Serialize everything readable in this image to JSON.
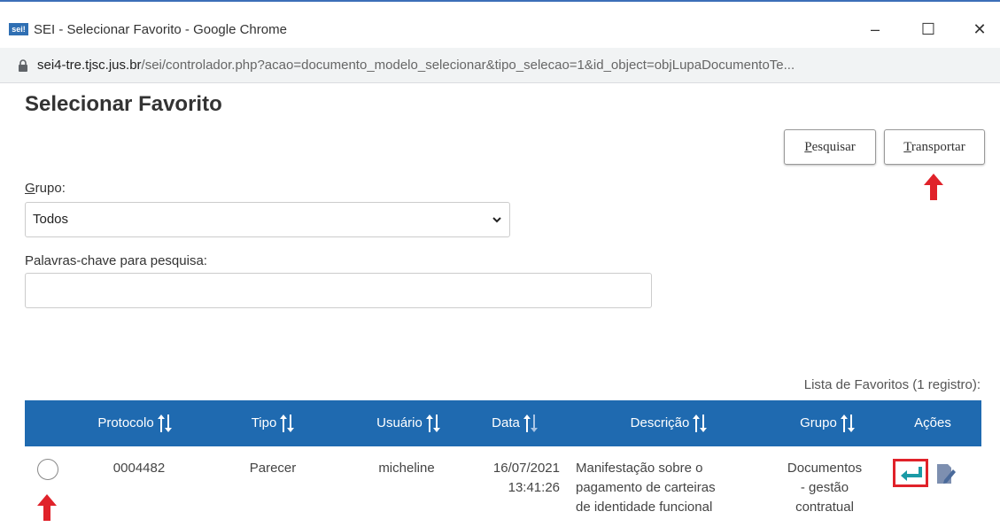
{
  "window": {
    "icon_text": "sei!",
    "title": "SEI - Selecionar Favorito - Google Chrome",
    "minimize": "–",
    "maximize": "☐",
    "close": "✕"
  },
  "address": {
    "host": "sei4-tre.tjsc.jus.br",
    "path": "/sei/controlador.php?acao=documento_modelo_selecionar&tipo_selecao=1&id_object=objLupaDocumentoTe..."
  },
  "page": {
    "title": "Selecionar Favorito",
    "buttons": {
      "pesquisar_accesskey": "P",
      "pesquisar_rest": "esquisar",
      "transportar_accesskey": "T",
      "transportar_rest": "ransportar"
    },
    "grupo": {
      "label_accesskey": "G",
      "label_rest": "rupo:",
      "selected": "Todos"
    },
    "keywords": {
      "label": "Palavras-chave para pesquisa:",
      "value": ""
    },
    "list_caption": "Lista de Favoritos (1 registro):"
  },
  "table": {
    "headers": {
      "protocolo": "Protocolo",
      "tipo": "Tipo",
      "usuario": "Usuário",
      "data": "Data",
      "descricao": "Descrição",
      "grupo": "Grupo",
      "acoes": "Ações"
    },
    "rows": [
      {
        "protocolo": "0004482",
        "tipo": "Parecer",
        "usuario": "micheline",
        "data_date": "16/07/2021",
        "data_time": "13:41:26",
        "descricao_1": "Manifestação sobre o",
        "descricao_2": "pagamento de carteiras",
        "descricao_3": "de identidade funcional",
        "grupo_1": "Documentos",
        "grupo_2": "- gestão",
        "grupo_3": "contratual"
      }
    ]
  },
  "colors": {
    "header_blue": "#1f6ab0",
    "highlight_red": "#e0222a",
    "action_teal": "#1a9aa6"
  }
}
